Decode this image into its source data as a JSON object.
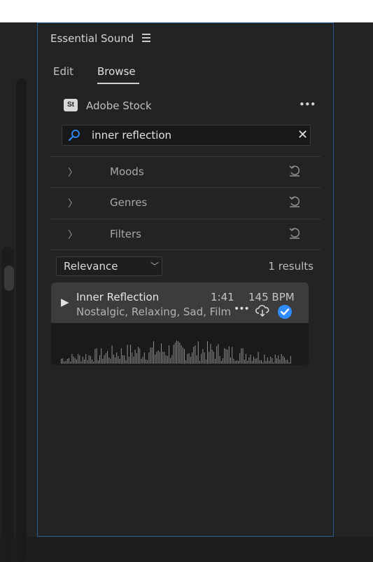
{
  "panel": {
    "title": "Essential Sound"
  },
  "tabs": [
    {
      "label": "Edit",
      "active": false
    },
    {
      "label": "Browse",
      "active": true
    }
  ],
  "source": {
    "badge": "St",
    "label": "Adobe Stock",
    "more": "•••"
  },
  "search": {
    "value": "inner reflection",
    "clear": "✕"
  },
  "facets": [
    {
      "label": "Moods"
    },
    {
      "label": "Genres"
    },
    {
      "label": "Filters"
    }
  ],
  "sort": {
    "selected": "Relevance",
    "caret": "﹀"
  },
  "results": {
    "count_label": "1 results"
  },
  "tracks": [
    {
      "title": "Inner Reflection",
      "duration": "1:41",
      "bpm": "145 BPM",
      "tags": "Nostalgic, Relaxing, Sad, Film,...",
      "more": "•••",
      "play": "▶",
      "licensed": true
    }
  ],
  "colors": {
    "accent": "#2f8cff",
    "panel_border": "#2a5d8f",
    "panel_bg": "#232323",
    "card_header": "#3c3c3c"
  }
}
